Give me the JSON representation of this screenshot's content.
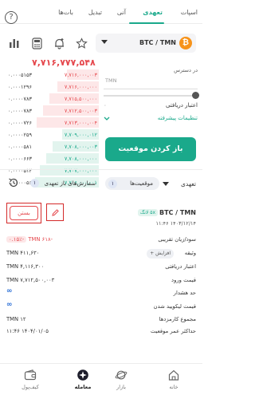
{
  "tabs": [
    {
      "label": "اسپات"
    },
    {
      "label": "تعهدی"
    },
    {
      "label": "آنی"
    },
    {
      "label": "تبدیل"
    },
    {
      "label": "بات‌ها"
    }
  ],
  "help_glyph": "?",
  "pair": {
    "base": "BTC",
    "quote": "TMN",
    "label": "BTC / TMN",
    "coin_glyph": "₿"
  },
  "last_price": "۷,۷۱۶,۷۷۷,۵۴۸",
  "order_book": {
    "sells": [
      {
        "price": "۷,۷۱۶,۰۰۰,۰۰۳",
        "qty": "۰.۰۰۰۵۱۵۳"
      },
      {
        "price": "۷,۷۱۶,۰۰۰,۰۰۰",
        "qty": "۰.۰۰۰۱۲۹۶"
      },
      {
        "price": "۷,۷۱۵,۵۰۰,۰۰۰",
        "qty": "۰.۰۰۰۰۷۸۳"
      },
      {
        "price": "۷,۷۱۲,۵۰۰,۰۰۳",
        "qty": "۰.۰۰۰۰۷۸۳"
      },
      {
        "price": "۷,۷۱۳,۰۰۰,۰۰۴",
        "qty": "۰.۰۰۰۰۷۲۶"
      }
    ],
    "buys": [
      {
        "price": "۷,۷۰۹,۰۰۰,۰۱۲",
        "qty": "۰.۰۰۰۰۲۵۹"
      },
      {
        "price": "۷,۷۰۸,۰۰۰,۰۰۳",
        "qty": "۰.۰۰۰۰۵۸۱"
      },
      {
        "price": "۷,۷۰۸,۰۰۰,۰۰۰",
        "qty": "۰.۰۰۰۰۶۶۳"
      },
      {
        "price": "۷,۷۰۷,۰۰۰,۰۰۰",
        "qty": "۰.۰۰۰۰۵۱۲"
      },
      {
        "price": "۷,۷۰۶,۰۰۰,۰۰۱",
        "qty": "۰.۰۰۰۰۰۵۶"
      }
    ]
  },
  "form": {
    "mode": "معامله",
    "available_label": "در دسترس",
    "amount_suffix": "TMN",
    "margin_label": "اعتبار دریافتی",
    "margin_value": "۰",
    "advanced_label": "تنظیمات پیشرفته",
    "submit_label": "باز کردن موقعیت"
  },
  "positions": {
    "filter_label": "تعهدی",
    "tab_positions_label": "موقعیت‌ها",
    "tab_positions_count": "۱",
    "tab_orders_label": "سفارش‌های باز تعهدی",
    "tab_orders_count": "۱",
    "close_label": "بستن"
  },
  "position": {
    "pair": "BTC / TMN",
    "side_badge": "۵x لانگ",
    "date": "۱۴۰۳/۱۲/۱۴ ۱۱:۴۶",
    "rows": [
      {
        "label": "سود/زیان تقریبی",
        "value": "-۶۱۸ TMN",
        "badge": "-۰.۱۵٪"
      },
      {
        "label": "وثیقه",
        "value": "۴۱۱,۶۳۰ TMN",
        "action": "افزایش"
      },
      {
        "label": "اعتبار دریافتی",
        "value": "۴,۱۱۶,۳۰۰ TMN"
      },
      {
        "label": "قیمت ورود",
        "value": "۷,۷۱۲,۵۰۰,۰۰۳ TMN"
      },
      {
        "label": "حد هشدار",
        "value": "∞"
      },
      {
        "label": "قیمت لیکویید شدن",
        "value": "∞"
      },
      {
        "label": "مجموع کارمزدها",
        "value": "۱۲ TMN"
      },
      {
        "label": "حداکثر عمر موقعیت",
        "value": "۱۴۰۴/۰۱/۰۵ ۱۱:۴۶"
      }
    ]
  },
  "bottom_nav": [
    {
      "label": "خانه",
      "icon": "home-icon"
    },
    {
      "label": "بازار",
      "icon": "market-icon"
    },
    {
      "label": "معامله",
      "icon": "trade-icon"
    },
    {
      "label": "کیف‌پول",
      "icon": "wallet-icon"
    }
  ],
  "colors": {
    "accent": "#1aa98b",
    "sell": "#e5484d",
    "buy": "#1aa98b",
    "highlight": "#d42a2a"
  }
}
